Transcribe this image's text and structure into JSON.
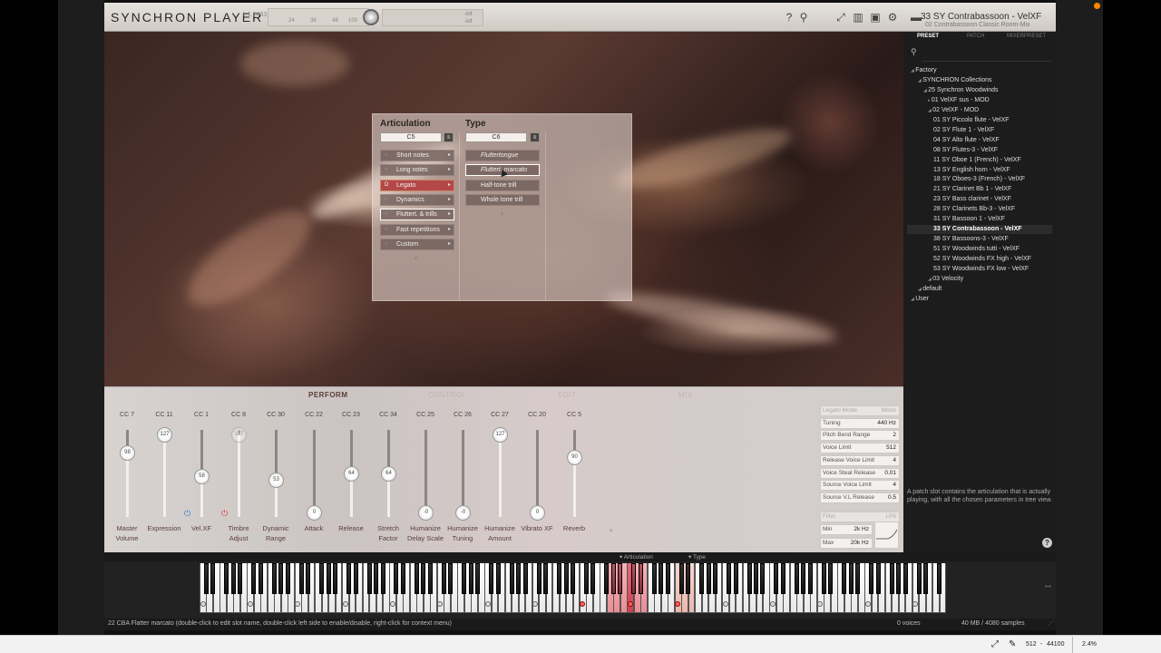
{
  "app": {
    "title": "SYNCHRON PLAYER",
    "version": "1.1.2063",
    "meter_ticks": [
      "24",
      "36",
      "48",
      "100"
    ],
    "vol_top": "-inf",
    "vol_bottom": "-inf",
    "preset_title": "33 SY Contrabassoon - VelXF",
    "preset_subtitle": "02 Contrabassoon Classic Room-Mix"
  },
  "panel": {
    "articulation_header": "Articulation",
    "type_header": "Type",
    "articulation_key": "C5",
    "type_key": "C6",
    "articulations": [
      {
        "label": "Short notes"
      },
      {
        "label": "Long notes"
      },
      {
        "label": "Legato",
        "key": "D"
      },
      {
        "label": "Dynamics"
      },
      {
        "label": "Fluttert. & trills"
      },
      {
        "label": "Fast repetitions"
      },
      {
        "label": "Custom"
      }
    ],
    "types": [
      {
        "label": "Fluttertongue"
      },
      {
        "label": "Fluttert. marcato"
      },
      {
        "label": "Half-tone trill"
      },
      {
        "label": "Whole tone trill"
      }
    ],
    "add_symbol": "+"
  },
  "sidebar": {
    "tabs": [
      "PRESET",
      "PATCH",
      "MIXERPRESET"
    ],
    "tree": [
      {
        "label": "Factory",
        "level": 0
      },
      {
        "label": "SYNCHRON Collections",
        "level": 1
      },
      {
        "label": "25 Synchron Woodwinds",
        "level": 2
      },
      {
        "label": "01 VelXF sus - MOD",
        "level": 3
      },
      {
        "label": "02 VelXF - MOD",
        "level": 3
      },
      {
        "label": "01 SY Piccolo flute - VelXF",
        "level": 4
      },
      {
        "label": "02 SY Flute 1 - VelXF",
        "level": 4
      },
      {
        "label": "04 SY Alto flute - VelXF",
        "level": 4
      },
      {
        "label": "08 SY Flutes-3 - VelXF",
        "level": 4
      },
      {
        "label": "11 SY Oboe 1 (French) - VelXF",
        "level": 4
      },
      {
        "label": "13 SY English horn - VelXF",
        "level": 4
      },
      {
        "label": "18 SY Oboes-3 (French) - VelXF",
        "level": 4
      },
      {
        "label": "21 SY Clarinet Bb 1 - VelXF",
        "level": 4
      },
      {
        "label": "23 SY Bass clarinet - VelXF",
        "level": 4
      },
      {
        "label": "28 SY Clarinets Bb-3 - VelXF",
        "level": 4
      },
      {
        "label": "31 SY Bassoon 1 - VelXF",
        "level": 4
      },
      {
        "label": "33 SY Contrabassoon - VelXF",
        "level": 4,
        "current": true
      },
      {
        "label": "38 SY Bassoons-3 - VelXF",
        "level": 4
      },
      {
        "label": "51 SY Woodwinds tutti - VelXF",
        "level": 4
      },
      {
        "label": "52 SY Woodwinds FX high - VelXF",
        "level": 4
      },
      {
        "label": "53 SY Woodwinds FX low - VelXF",
        "level": 4
      },
      {
        "label": "03 Velocity",
        "level": 3
      },
      {
        "label": "default",
        "level": 1
      },
      {
        "label": "User",
        "level": 0
      }
    ],
    "hint": "A patch slot contains the articulation that is actually playing, with all the chosen parameters in tree view."
  },
  "perform": {
    "tabs": [
      "PERFORM",
      "CONTROL",
      "EDIT",
      "MIX"
    ],
    "sliders": [
      {
        "cc": "CC 7",
        "label": "Master Volume",
        "value": "98",
        "norm": 0.77
      },
      {
        "cc": "CC 11",
        "label": "Expression",
        "value": "127",
        "norm": 1.0
      },
      {
        "cc": "CC 1",
        "label": "Vel.XF",
        "value": "58",
        "norm": 0.46,
        "power": "blue"
      },
      {
        "cc": "CC 8",
        "label": "Timbre Adjust",
        "value": "127",
        "norm": 1.0,
        "power": "red",
        "disabled": true
      },
      {
        "cc": "CC 30",
        "label": "Dynamic Range",
        "value": "53",
        "norm": 0.42
      },
      {
        "cc": "CC 22",
        "label": "Attack",
        "value": "0",
        "norm": 0
      },
      {
        "cc": "CC 23",
        "label": "Release",
        "value": "64",
        "norm": 0.5
      },
      {
        "cc": "CC 34",
        "label": "Stretch Factor",
        "value": "64",
        "norm": 0.5
      },
      {
        "cc": "CC 25",
        "label": "Humanize Delay Scale",
        "value": "-0",
        "norm": 0
      },
      {
        "cc": "CC 26",
        "label": "Humanize Tuning",
        "value": "-0",
        "norm": 0
      },
      {
        "cc": "CC 27",
        "label": "Humanize Amount",
        "value": "127",
        "norm": 1.0
      },
      {
        "cc": "CC 20",
        "label": "Vibrato XF",
        "value": "0",
        "norm": 0
      },
      {
        "cc": "CC 5",
        "label": "Reverb",
        "value": "90",
        "norm": 0.71
      }
    ],
    "add_symbol": "+",
    "params": [
      {
        "name": "Legato Mode",
        "value": "Mono",
        "dim": true
      },
      {
        "name": "Tuning",
        "value": "440 Hz"
      },
      {
        "name": "Pitch Bend Range",
        "value": "2"
      },
      {
        "name": "Voice Limit",
        "value": "512"
      },
      {
        "name": "Release Voice Limit",
        "value": "4"
      },
      {
        "name": "Voice Steal Release",
        "value": "0.01"
      },
      {
        "name": "Source Voice Limit",
        "value": "4"
      },
      {
        "name": "Source V.L Release",
        "value": "0.5"
      }
    ],
    "filter": {
      "label": "Filter",
      "type": "LP6",
      "min_label": "Min",
      "min": "2k Hz",
      "max_label": "Max",
      "max": "20k Hz"
    }
  },
  "keyboard": {
    "articulation_label": "▾ Articulation",
    "type_label": "▾ Type"
  },
  "status": {
    "message": "22 CBA Flatter marcato (double-click to edit slot name, double-click left side to enable/disable, right-click for context menu)",
    "voices": "0 voices",
    "memory": "40 MB / 4080 samples"
  },
  "taskbar": {
    "buffer": "512",
    "rate": "44100",
    "cpu": "2.4%"
  }
}
